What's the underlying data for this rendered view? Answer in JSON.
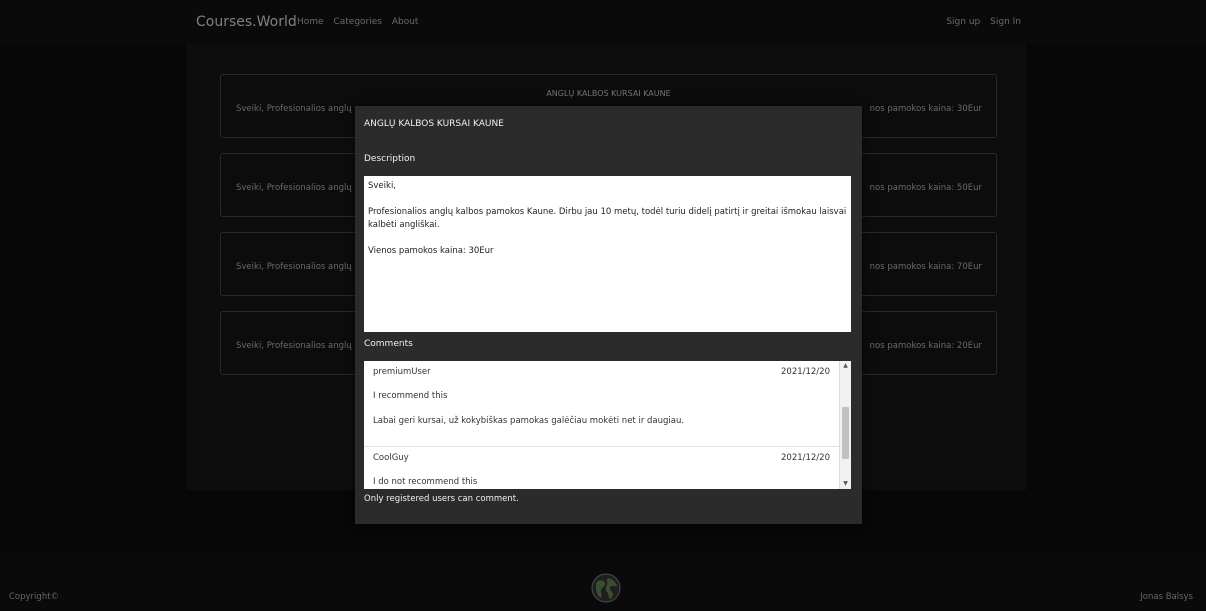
{
  "navbar": {
    "brand": "Courses.World",
    "links": [
      "Home",
      "Categories",
      "About"
    ],
    "right_links": [
      "Sign up",
      "Sign In"
    ]
  },
  "courses": [
    {
      "title": "ANGLŲ KALBOS KURSAI KAUNE",
      "left_text": "Sveiki, Profesionalios anglų",
      "right_text": "nos pamokos kaina: 30Eur"
    },
    {
      "title": "",
      "left_text": "Sveiki, Profesionalios anglų",
      "right_text": "nos pamokos kaina: 50Eur"
    },
    {
      "title": "",
      "left_text": "Sveiki, Profesionalios anglų",
      "right_text": "nos pamokos kaina: 70Eur"
    },
    {
      "title": "",
      "left_text": "Sveiki, Profesionalios anglų",
      "right_text": "nos pamokos kaina: 20Eur"
    }
  ],
  "modal": {
    "title": "ANGLŲ KALBOS KURSAI KAUNE",
    "description_label": "Description",
    "description": {
      "greeting": "Sveiki,",
      "paragraph": "Profesionalios anglų kalbos pamokos Kaune. Dirbu jau 10 metų, todėl turiu didelį patirtį ir greitai išmokau laisvai kalbėti angliškai.",
      "price": "Vienos pamokos kaina: 30Eur"
    },
    "comments_label": "Comments",
    "comments": [
      {
        "user": "premiumUser",
        "date": "2021/12/20",
        "recommendation": "I recommend this",
        "body": "Labai geri kursai, už kokybiškas pamokas galėčiau mokėti net ir daugiau."
      },
      {
        "user": "CoolGuy",
        "date": "2021/12/20",
        "recommendation": "I do not recommend this",
        "body": ""
      }
    ],
    "note": "Only registered users can comment."
  },
  "footer": {
    "copyright": "Copyright©",
    "author": "Jonas Balsys",
    "logo_icon": "globe-icon"
  },
  "colors": {
    "background": "#0e0e0e",
    "navbar": "#131313",
    "modal": "#2b2b2b",
    "card_border": "#4a4a4a"
  }
}
